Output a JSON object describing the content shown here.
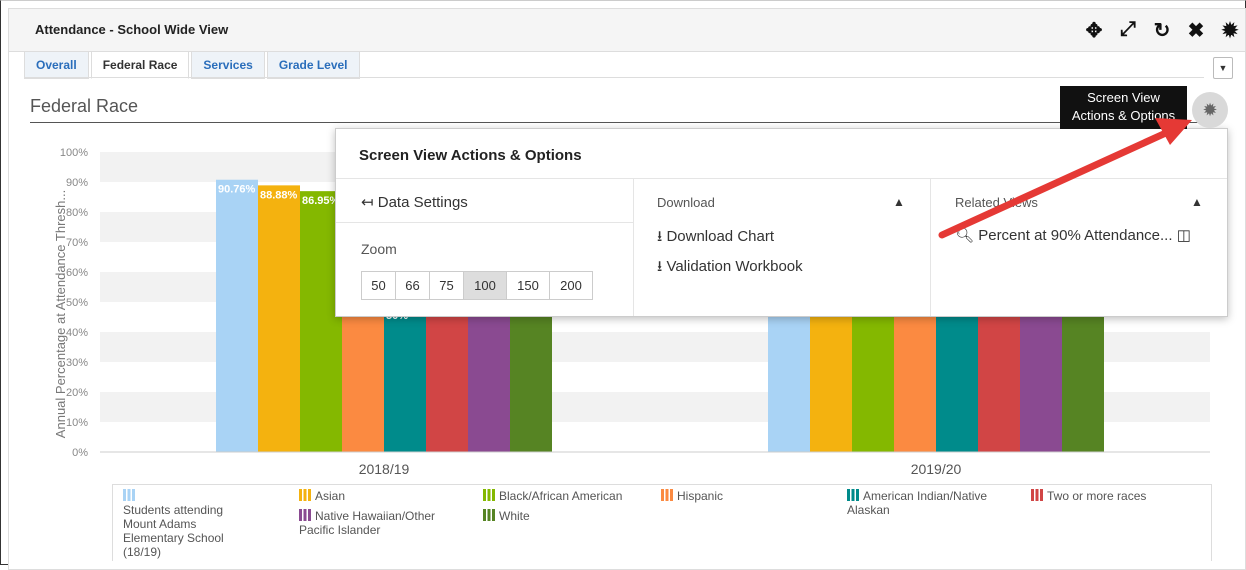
{
  "window": {
    "title": "Attendance - School Wide View"
  },
  "toolbar_icons": [
    "move-icon",
    "expand-icon",
    "refresh-icon",
    "close-icon",
    "settings-gear-icon"
  ],
  "tabs": [
    {
      "label": "Overall",
      "active": false
    },
    {
      "label": "Federal Race",
      "active": true
    },
    {
      "label": "Services",
      "active": false
    },
    {
      "label": "Grade Level",
      "active": false
    }
  ],
  "section": {
    "title": "Federal Race"
  },
  "tooltip": {
    "line1": "Screen View",
    "line2": "Actions & Options"
  },
  "popup": {
    "title": "Screen View Actions & Options",
    "data_settings": "Data Settings",
    "zoom_label": "Zoom",
    "zoom_options": [
      "50",
      "66",
      "75",
      "100",
      "150",
      "200"
    ],
    "zoom_selected": "100",
    "download_header": "Download",
    "download_chart": "Download Chart",
    "validation_workbook": "Validation Workbook",
    "related_header": "Related Views",
    "related_item": "Percent at 90% Attendance..."
  },
  "chart_data": {
    "type": "bar",
    "ylabel": "Annual Percentage at Attendance Thresh...",
    "ylim": [
      0,
      100
    ],
    "yticks": [
      "0%",
      "10%",
      "20%",
      "30%",
      "40%",
      "50%",
      "60%",
      "70%",
      "80%",
      "90%",
      "100%"
    ],
    "categories": [
      "2018/19",
      "2019/20"
    ],
    "series": [
      {
        "name": "Students attending Mount Adams Elementary School (18/19)",
        "color": "#a9d3f5",
        "values": [
          90.76,
          null
        ],
        "label": "90.76%"
      },
      {
        "name": "Asian",
        "color": "#f4b20f",
        "values": [
          88.88,
          null
        ],
        "label": "88.88%"
      },
      {
        "name": "Black/African American",
        "color": "#84b800",
        "values": [
          86.95,
          null
        ],
        "label": "86.95%"
      },
      {
        "name": "Hispanic",
        "color": "#fb8a41",
        "values": [
          null,
          null
        ],
        "label": ""
      },
      {
        "name": "American Indian/Native Alaskan",
        "color": "#008b8b",
        "values": [
          null,
          null
        ],
        "label": "50%"
      },
      {
        "name": "Two or more races",
        "color": "#d14545",
        "values": [
          null,
          null
        ],
        "label": ""
      },
      {
        "name": "Native Hawaiian/Other Pacific Islander",
        "color": "#8a4a91",
        "values": [
          null,
          null
        ],
        "label": ""
      },
      {
        "name": "White",
        "color": "#568423",
        "values": [
          null,
          null
        ],
        "label": ""
      }
    ],
    "legend": [
      {
        "name": "Students attending Mount Adams Elementary School (18/19)",
        "color": "#a9d3f5"
      },
      {
        "name": "Asian",
        "color": "#f4b20f"
      },
      {
        "name": "Native Hawaiian/Other Pacific Islander",
        "color": "#8a4a91"
      },
      {
        "name": "Black/African American",
        "color": "#84b800"
      },
      {
        "name": "White",
        "color": "#568423"
      },
      {
        "name": "Hispanic",
        "color": "#fb8a41"
      },
      {
        "name": "American Indian/Native Alaskan",
        "color": "#008b8b"
      },
      {
        "name": "Two or more races",
        "color": "#d14545"
      }
    ]
  }
}
